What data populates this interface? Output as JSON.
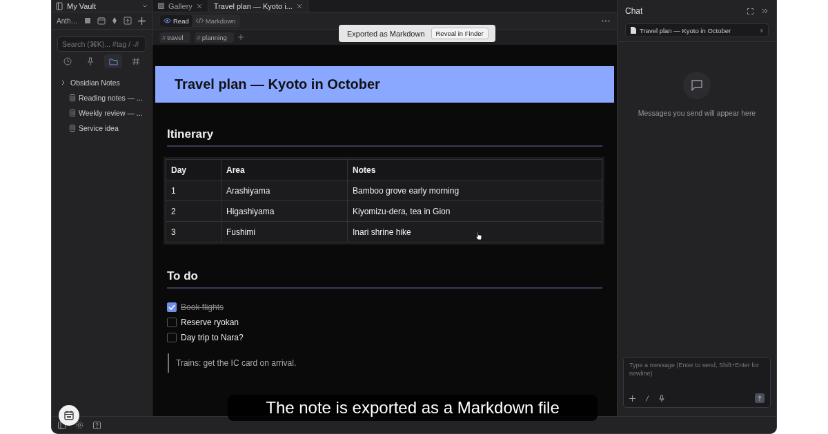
{
  "vault": {
    "name": "My Vault"
  },
  "sidebar_toolbar": {
    "label": "Anth…"
  },
  "search": {
    "placeholder": "Search (⌘K)... #tag / -#"
  },
  "nav_tabs": [
    {
      "kind": "recent",
      "selected": false
    },
    {
      "kind": "pinned",
      "selected": false
    },
    {
      "kind": "folders",
      "selected": true
    },
    {
      "kind": "tags",
      "selected": false
    }
  ],
  "file_tree": [
    {
      "kind": "folder",
      "label": "Obsidian Notes",
      "expanded": false
    },
    {
      "kind": "file",
      "label": "Reading notes — ..."
    },
    {
      "kind": "file",
      "label": "Weekly review — ..."
    },
    {
      "kind": "file",
      "label": "Service idea"
    }
  ],
  "tabs": [
    {
      "label": "Gallery",
      "selected": false
    },
    {
      "label": "Travel plan — Kyoto i...",
      "selected": true
    }
  ],
  "view_modes": [
    {
      "kind": "read",
      "label": "Read",
      "selected": true
    },
    {
      "kind": "markdown",
      "label": "Markdown",
      "selected": false
    }
  ],
  "tags": [
    {
      "symbol": "#",
      "label": "travel"
    },
    {
      "symbol": "#",
      "label": "planning"
    }
  ],
  "toast": {
    "message": "Exported as Markdown",
    "action": "Reveal in Finder"
  },
  "note": {
    "title": "Travel plan — Kyoto in October",
    "itinerary_heading": "Itinerary",
    "table": {
      "columns": [
        "Day",
        "Area",
        "Notes"
      ],
      "rows": [
        [
          "1",
          "Arashiyama",
          "Bamboo grove early morning"
        ],
        [
          "2",
          "Higashiyama",
          "Kiyomizu-dera, tea in Gion"
        ],
        [
          "3",
          "Fushimi",
          "Inari shrine hike"
        ]
      ]
    },
    "todo_heading": "To do",
    "todos": [
      {
        "label": "Book flights",
        "checked": true
      },
      {
        "label": "Reserve ryokan",
        "checked": false
      },
      {
        "label": "Day trip to Nara?",
        "checked": false
      }
    ],
    "quote": "Trains: get the IC card on arrival."
  },
  "chat": {
    "title": "Chat",
    "attachment": "Travel plan — Kyoto in October",
    "remove": "x",
    "empty_message": "Messages you send will appear here",
    "input": {
      "placeholder": "Type a message (Enter to send, Shift+Enter for newline)"
    }
  },
  "caption": "The note is exported as a Markdown file"
}
